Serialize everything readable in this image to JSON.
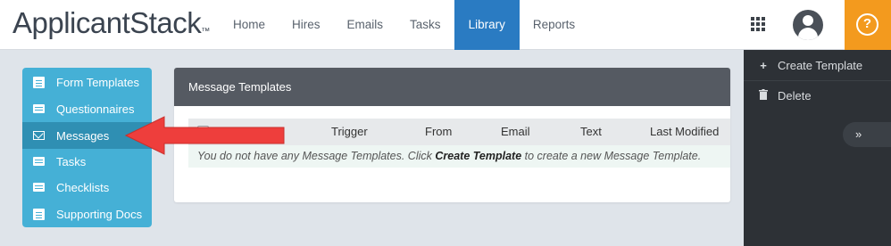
{
  "brand": {
    "logo_text": "ApplicantStack",
    "trademark": "™"
  },
  "nav": {
    "items": [
      {
        "label": "Home",
        "active": false
      },
      {
        "label": "Hires",
        "active": false
      },
      {
        "label": "Emails",
        "active": false
      },
      {
        "label": "Tasks",
        "active": false
      },
      {
        "label": "Library",
        "active": true
      },
      {
        "label": "Reports",
        "active": false
      }
    ],
    "help_glyph": "?"
  },
  "sidebar": {
    "items": [
      {
        "label": "Form Templates",
        "icon": "document-icon"
      },
      {
        "label": "Questionnaires",
        "icon": "list-icon"
      },
      {
        "label": "Messages",
        "icon": "envelope-icon",
        "active": true
      },
      {
        "label": "Tasks",
        "icon": "list-icon"
      },
      {
        "label": "Checklists",
        "icon": "list-icon"
      },
      {
        "label": "Supporting Docs",
        "icon": "document-icon"
      }
    ]
  },
  "panel": {
    "title": "Message Templates",
    "columns": [
      "Name",
      "Trigger",
      "From",
      "Email",
      "Text",
      "Last Modified"
    ],
    "sort_indicator": "▲",
    "empty_message": {
      "before": "You do not have any Message Templates. Click ",
      "bold": "Create Template",
      "after": " to create a new Message Template."
    }
  },
  "right_panel": {
    "actions": [
      {
        "label": "Create Template",
        "icon": "plus-icon",
        "glyph": "+"
      },
      {
        "label": "Delete",
        "icon": "trash-icon",
        "glyph": "🗑"
      }
    ],
    "collapse_glyph": "»"
  },
  "colors": {
    "nav_active": "#2a7bc2",
    "sidebar": "#45b0d6",
    "sidebar_active": "#2f8fb3",
    "help": "#f39a1e",
    "arrow": "#ee3e3c",
    "panel_header": "#555a62",
    "right_panel": "#2d3136"
  }
}
